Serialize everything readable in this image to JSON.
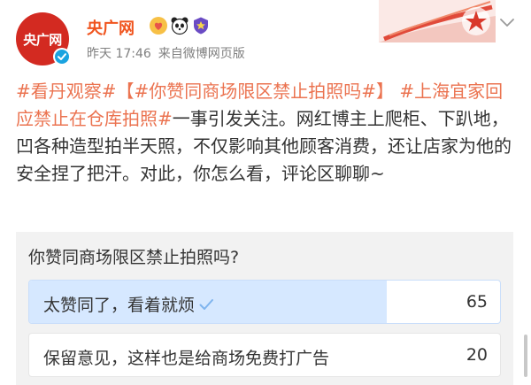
{
  "header": {
    "avatar_text": "央广网",
    "username": "央广网",
    "time": "昨天 17:46",
    "source": "来自微博网页版"
  },
  "post": {
    "tag1": "#看丹观察#",
    "tag2": "【#你赞同商场限区禁止拍照吗#】",
    "tag3": "#上海宜家回应禁止在仓库拍照#",
    "body": "一事引发关注。网红博主上爬柜、下趴地，凹各种造型拍半天照，不仅影响其他顾客消费，还让店家为他的安全捏了把汗。对此，你怎么看，评论区聊聊~"
  },
  "poll": {
    "question": "你赞同商场限区禁止拍照吗?",
    "options": [
      {
        "label": "太赞同了，看着就烦",
        "count": "65",
        "fill_fraction": 0.76,
        "selected": true
      },
      {
        "label": "保留意见，这样也是给商场免费打广告",
        "count": "20",
        "fill_fraction": 0.0,
        "selected": false
      }
    ]
  },
  "colors": {
    "username": "#f0541e",
    "hashtag": "#eb7350",
    "poll_fill_selected": "#d6e8ff",
    "check": "#7fb4ee",
    "avatar": "#d32a21",
    "verified": "#1aa3e0"
  },
  "icons": {
    "verified": "verified-check-icon",
    "badge1": "heart-badge-icon",
    "badge2": "panda-icon",
    "badge3": "shield-badge-icon",
    "menu": "chevron-down-icon",
    "selected": "checkmark-icon"
  }
}
